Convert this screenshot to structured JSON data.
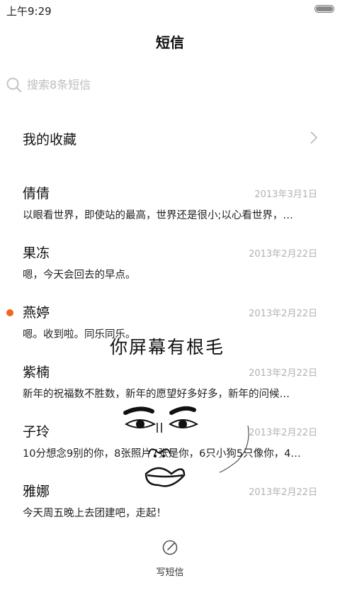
{
  "status_bar": {
    "time": "上午9:29"
  },
  "header": {
    "title": "短信"
  },
  "search": {
    "placeholder": "搜索8条短信"
  },
  "favorites": {
    "label": "我的收藏"
  },
  "messages": [
    {
      "name": "倩倩",
      "date": "2013年3月1日",
      "preview": "以眼看世界，即使站的最高，世界还是很小;以心看世界，…",
      "unread": false
    },
    {
      "name": "果冻",
      "date": "2013年2月22日",
      "preview": "嗯，今天会回去的早点。",
      "unread": false
    },
    {
      "name": "燕婷",
      "date": "2013年2月22日",
      "preview": "嗯。收到啦。同乐同乐。",
      "unread": true
    },
    {
      "name": "紫楠",
      "date": "2013年2月22日",
      "preview": "新年的祝福数不胜数，新年的愿望好多好多，新年的问候…",
      "unread": false
    },
    {
      "name": "子玲",
      "date": "2013年2月22日",
      "preview": "10分想念9别的你，8张照片7张是你，6只小狗5只像你，4…",
      "unread": false
    },
    {
      "name": "雅娜",
      "date": "2013年2月22日",
      "preview": "今天周五晚上去团建吧，走起！",
      "unread": false
    }
  ],
  "overlay": {
    "text": "你屏幕有根毛"
  },
  "compose": {
    "label": "写短信"
  },
  "colors": {
    "unread_dot": "#f26523",
    "date": "#b3b3b3",
    "placeholder": "#bdbdbd"
  }
}
